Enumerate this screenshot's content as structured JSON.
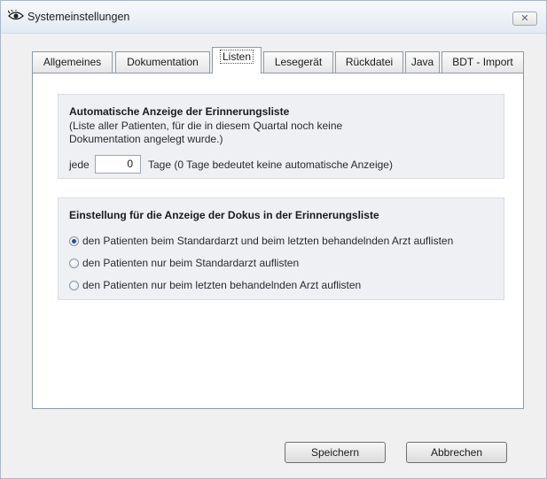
{
  "window": {
    "title": "Systemeinstellungen",
    "close_symbol": "✕"
  },
  "tabs": [
    {
      "label": "Allgemeines"
    },
    {
      "label": "Dokumentation"
    },
    {
      "label": "Listen"
    },
    {
      "label": "Lesegerät"
    },
    {
      "label": "Rückdatei"
    },
    {
      "label": "Java"
    },
    {
      "label": "BDT - Import"
    }
  ],
  "active_tab": "Listen",
  "auto_display": {
    "title": "Automatische Anzeige der Erinnerungsliste",
    "desc_line1": "(Liste aller Patienten, für die in diesem Quartal noch keine",
    "desc_line2": "Dokumentation angelegt wurde.)",
    "prefix": "jede",
    "days_value": "0",
    "suffix": "Tage  (0 Tage bedeutet keine automatische Anzeige)"
  },
  "docs_display": {
    "title": "Einstellung für die Anzeige der Dokus in der Erinnerungsliste",
    "options": [
      {
        "label": "den Patienten beim Standardarzt und beim letzten behandelnden Arzt auflisten",
        "checked": true
      },
      {
        "label": "den Patienten nur beim Standardarzt auflisten",
        "checked": false
      },
      {
        "label": "den Patienten nur beim letzten behandelnden Arzt auflisten",
        "checked": false
      }
    ]
  },
  "buttons": {
    "save": "Speichern",
    "cancel": "Abbrechen"
  }
}
